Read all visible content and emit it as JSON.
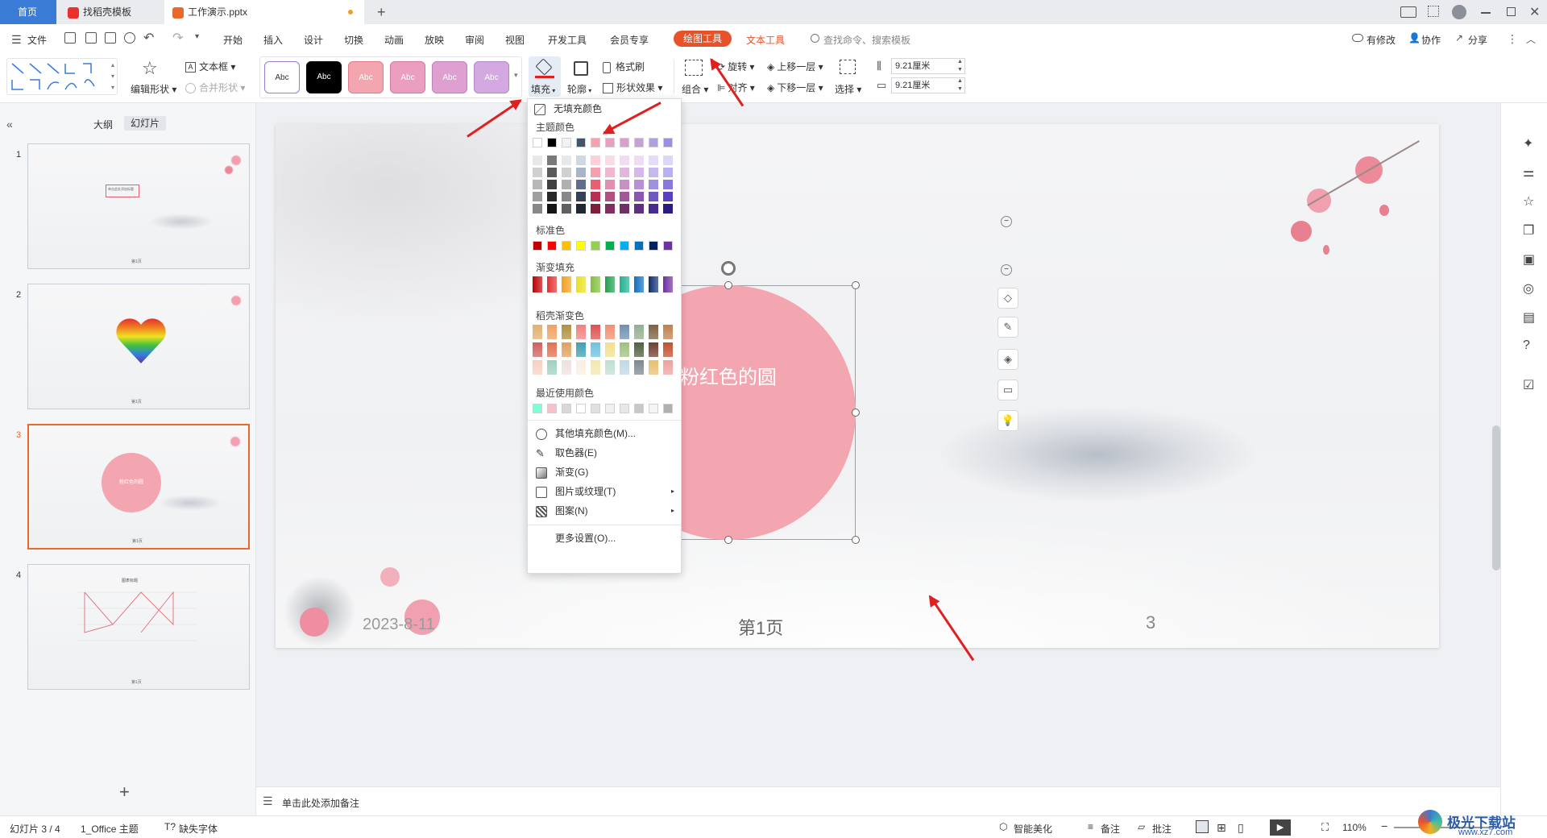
{
  "tabs": {
    "home": "首页",
    "template": "找稻壳模板",
    "doc": "工作演示.pptx",
    "new_tab": "+"
  },
  "menu": {
    "file": "文件",
    "items": [
      "开始",
      "插入",
      "设计",
      "切换",
      "动画",
      "放映",
      "审阅",
      "视图",
      "开发工具",
      "会员专享"
    ],
    "drawing_tools": "绘图工具",
    "text_tools": "文本工具",
    "search": "查找命令、搜索模板",
    "has_changes": "有修改",
    "collab": "协作",
    "share": "分享"
  },
  "ribbon": {
    "edit_shape": "编辑形状",
    "text_box": "文本框",
    "merge_shape": "合并形状",
    "style_label": "Abc",
    "fill": "填充",
    "outline": "轮廓",
    "format_painter": "格式刷",
    "shape_effect": "形状效果",
    "group": "组合",
    "rotate": "旋转",
    "align": "对齐",
    "bring_forward": "上移一层",
    "send_backward": "下移一层",
    "select": "选择",
    "height": "9.21厘米",
    "width": "9.21厘米"
  },
  "left_pane": {
    "outline_tab": "大纲",
    "slides_tab": "幻灯片",
    "slide_numbers": [
      "1",
      "2",
      "3",
      "4"
    ],
    "slide1_box": "单击此处添加标题",
    "slide3_circle": "粉红色的圆",
    "slide4_chart_title": "图表标题",
    "thumb_footer": "第1页",
    "add_slide": "+"
  },
  "fill_menu": {
    "no_fill": "无填充颜色",
    "theme_colors": "主题颜色",
    "standard_colors": "标准色",
    "gradient_fill": "渐变填充",
    "docer_gradient": "稻壳渐变色",
    "recent_colors": "最近使用颜色",
    "more_fill": "其他填充颜色(M)...",
    "eyedropper": "取色器(E)",
    "gradient": "渐变(G)",
    "picture_texture": "图片或纹理(T)",
    "pattern": "图案(N)",
    "more_settings": "更多设置(O)...",
    "theme_top_row": [
      "#ffffff",
      "#000000",
      "#f2f2f2",
      "#44546a",
      "#f8a0b0",
      "#e8a0c0",
      "#d8a0d0",
      "#c8a0d8",
      "#b0a0e0",
      "#9890e0"
    ],
    "standard": [
      "#c00000",
      "#ff0000",
      "#ffc000",
      "#ffff00",
      "#92d050",
      "#00b050",
      "#00b0f0",
      "#0070c0",
      "#002060",
      "#7030a0"
    ],
    "gradients": [
      "#c00000",
      "#e03030",
      "#f0a020",
      "#e8e020",
      "#80c040",
      "#20a050",
      "#20b090",
      "#1070c0",
      "#103070",
      "#7030a0"
    ],
    "recent": [
      "#7fffd4",
      "#f8c0c8",
      "#d8d8d8",
      "#ffffff",
      "#e0e0e0",
      "#f0f0f0",
      "#e8e8e8",
      "#c8c8c8",
      "#f5f5f5",
      "#b0b0b0"
    ]
  },
  "slide": {
    "circle_text": "粉红色的圆",
    "date": "2023-8-11",
    "footer": "第1页",
    "page_num": "3",
    "circle_color": "#f4a6b0"
  },
  "notes": {
    "placeholder": "单击此处添加备注"
  },
  "status": {
    "slide_info": "幻灯片 3 / 4",
    "theme": "1_Office 主题",
    "missing_font": "缺失字体",
    "smart_beautify": "智能美化",
    "notes": "备注",
    "comments": "批注",
    "zoom": "110%",
    "watermark": "极光下载站",
    "watermark_url": "www.xz7.com"
  },
  "colors": {
    "accent_orange": "#e8692c",
    "drawing_tools_bg": "#e8522b",
    "arrow_red": "#e02020"
  }
}
